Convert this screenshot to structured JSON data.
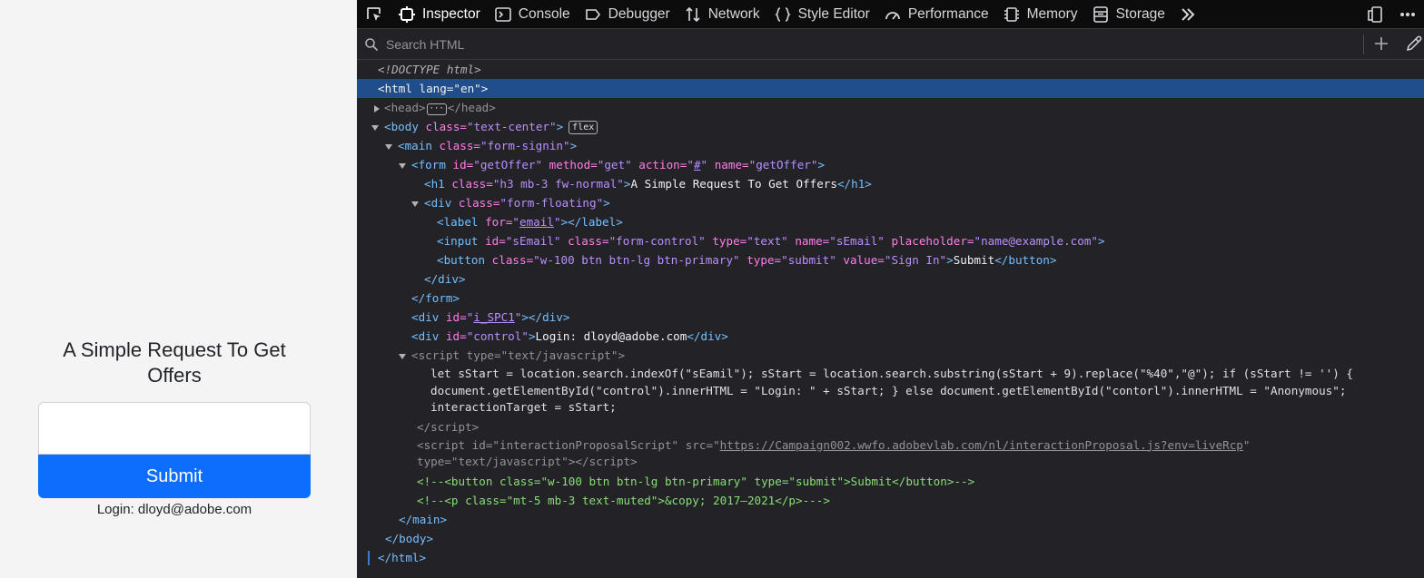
{
  "page": {
    "heading": "A Simple Request To Get Offers",
    "submit_label": "Submit",
    "login_text": "Login: dloyd@adobe.com"
  },
  "devtools": {
    "tabs": [
      {
        "label": "Inspector",
        "icon": "inspector-icon",
        "active": true
      },
      {
        "label": "Console",
        "icon": "console-icon"
      },
      {
        "label": "Debugger",
        "icon": "debugger-icon"
      },
      {
        "label": "Network",
        "icon": "network-icon"
      },
      {
        "label": "Style Editor",
        "icon": "style-editor-icon"
      },
      {
        "label": "Performance",
        "icon": "performance-icon"
      },
      {
        "label": "Memory",
        "icon": "memory-icon"
      },
      {
        "label": "Storage",
        "icon": "storage-icon"
      }
    ],
    "search_placeholder": "Search HTML",
    "badge_flex": "flex",
    "tree": {
      "doctype": "<!DOCTYPE html>",
      "html_open": "<html lang=\"en\">",
      "head_open": "<head>",
      "head_close": "</head>",
      "body_open": "<body",
      "body_class_attr": " class=",
      "body_class_val": "\"text-center\"",
      "main_class_val": "\"form-signin\"",
      "form_id_val": "\"getOffer\"",
      "form_method_val": "\"get\"",
      "form_action_val": "#",
      "form_name_val": "\"getOffer\"",
      "h1_class_val": "\"h3 mb-3 fw-normal\"",
      "h1_text": "A Simple Request To Get Offers",
      "div_floating_class_val": "\"form-floating\"",
      "label_for_val": "email",
      "input_id_val": "\"sEmail\"",
      "input_class_val": "\"form-control\"",
      "input_type_val": "\"text\"",
      "input_name_val": "\"sEmail\"",
      "input_placeholder_val": "\"name@example.com\"",
      "button_class_val": "\"w-100 btn btn-lg btn-primary\"",
      "button_type_val": "\"submit\"",
      "button_value_val": "\"Sign In\"",
      "button_text": "Submit",
      "div_spc_id_val": "i_SPC1",
      "div_control_id_val": "\"control\"",
      "div_control_text": "Login: dloyd@adobe.com",
      "script_type_val": "\"text/javascript\"",
      "script_code": "let sStart = location.search.indexOf(\"sEamil\"); sStart = location.search.substring(sStart + 9).replace(\"%40\",\"@\"); if (sStart != '') {\ndocument.getElementById(\"control\").innerHTML = \"Login: \" + sStart; } else document.getElementById(\"contorl\").innerHTML = \"Anonymous\";\ninteractionTarget = sStart;",
      "script2_id_val": "\"interactionProposalScript\"",
      "script2_src_val": "https://Campaign002.wwfo.adobevlab.com/nl/interactionProposal.js?env=liveRcp",
      "script2_type_val": "\"text/javascript\"",
      "comment1": "<!--<button class=\"w-100 btn btn-lg btn-primary\" type=\"submit\">Submit</button>-->",
      "comment2": "<!--<p class=\"mt-5 mb-3 text-muted\">&copy; 2017–2021</p>--->",
      "main_close": "</main>",
      "body_close": "</body>",
      "html_close": "</html>"
    }
  }
}
